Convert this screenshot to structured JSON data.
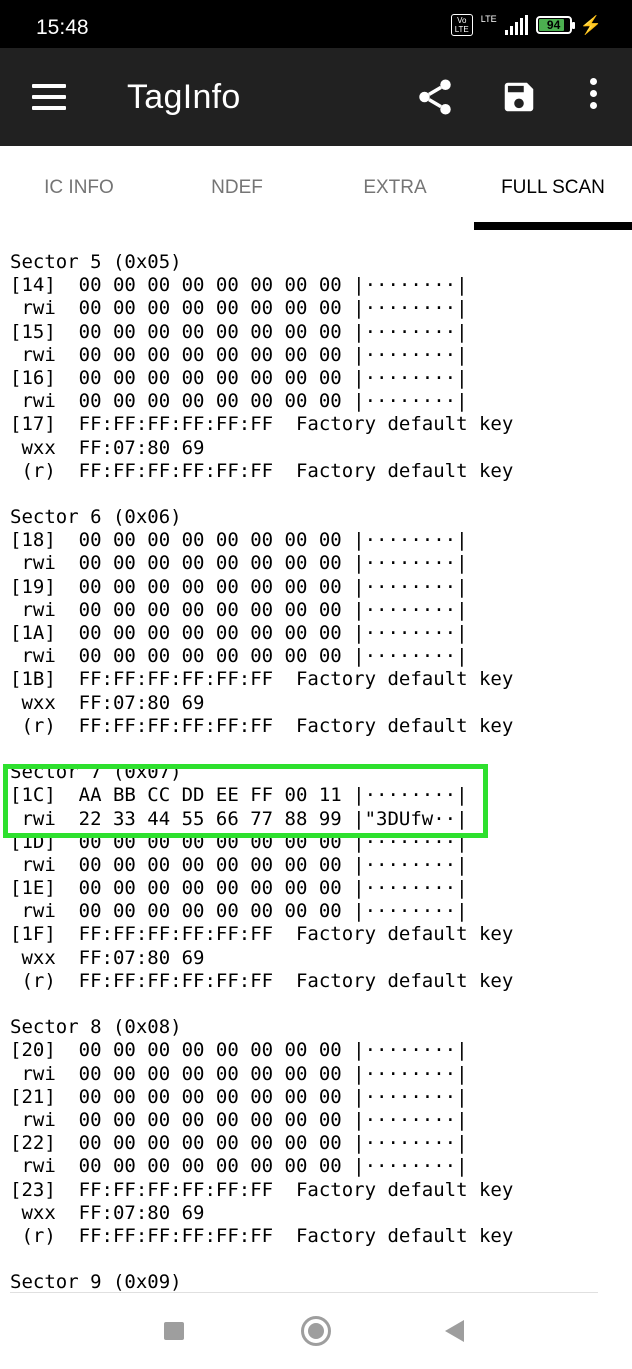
{
  "status_bar": {
    "time": "15:48",
    "volte_label": "Vo LTE",
    "network_label": "LTE",
    "battery_level": "94"
  },
  "app_bar": {
    "title": "TagInfo",
    "icons": [
      "menu-icon",
      "share-icon",
      "save-icon",
      "more-vert-icon"
    ]
  },
  "tabs": [
    {
      "label": "IC INFO",
      "active": false
    },
    {
      "label": "NDEF",
      "active": false
    },
    {
      "label": "EXTRA",
      "active": false
    },
    {
      "label": "FULL SCAN",
      "active": true
    }
  ],
  "scan_lines": [
    "Sector 5 (0x05)",
    "[14]  00 00 00 00 00 00 00 00 |········|",
    " rwi  00 00 00 00 00 00 00 00 |········|",
    "[15]  00 00 00 00 00 00 00 00 |········|",
    " rwi  00 00 00 00 00 00 00 00 |········|",
    "[16]  00 00 00 00 00 00 00 00 |········|",
    " rwi  00 00 00 00 00 00 00 00 |········|",
    "[17]  FF:FF:FF:FF:FF:FF  Factory default key",
    " wxx  FF:07:80 69",
    " (r)  FF:FF:FF:FF:FF:FF  Factory default key",
    "",
    "Sector 6 (0x06)",
    "[18]  00 00 00 00 00 00 00 00 |········|",
    " rwi  00 00 00 00 00 00 00 00 |········|",
    "[19]  00 00 00 00 00 00 00 00 |········|",
    " rwi  00 00 00 00 00 00 00 00 |········|",
    "[1A]  00 00 00 00 00 00 00 00 |········|",
    " rwi  00 00 00 00 00 00 00 00 |········|",
    "[1B]  FF:FF:FF:FF:FF:FF  Factory default key",
    " wxx  FF:07:80 69",
    " (r)  FF:FF:FF:FF:FF:FF  Factory default key",
    "",
    "Sector 7 (0x07)",
    "[1C]  AA BB CC DD EE FF 00 11 |········|",
    " rwi  22 33 44 55 66 77 88 99 |\"3DUfw··|",
    "[1D]  00 00 00 00 00 00 00 00 |········|",
    " rwi  00 00 00 00 00 00 00 00 |········|",
    "[1E]  00 00 00 00 00 00 00 00 |········|",
    " rwi  00 00 00 00 00 00 00 00 |········|",
    "[1F]  FF:FF:FF:FF:FF:FF  Factory default key",
    " wxx  FF:07:80 69",
    " (r)  FF:FF:FF:FF:FF:FF  Factory default key",
    "",
    "Sector 8 (0x08)",
    "[20]  00 00 00 00 00 00 00 00 |········|",
    " rwi  00 00 00 00 00 00 00 00 |········|",
    "[21]  00 00 00 00 00 00 00 00 |········|",
    " rwi  00 00 00 00 00 00 00 00 |········|",
    "[22]  00 00 00 00 00 00 00 00 |········|",
    " rwi  00 00 00 00 00 00 00 00 |········|",
    "[23]  FF:FF:FF:FF:FF:FF  Factory default key",
    " wxx  FF:07:80 69",
    " (r)  FF:FF:FF:FF:FF:FF  Factory default key",
    "",
    "Sector 9 (0x09)"
  ],
  "highlight_color": "#2ee02e",
  "nav_bar": {
    "icons": [
      "recents-square-icon",
      "home-circle-icon",
      "back-triangle-icon"
    ]
  }
}
